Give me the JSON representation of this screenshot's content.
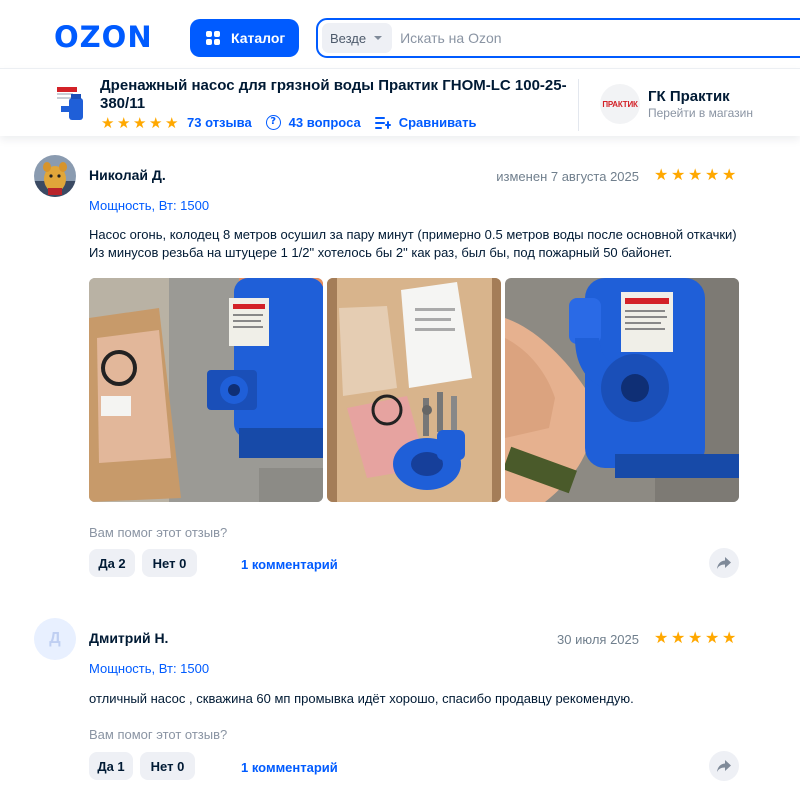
{
  "header": {
    "logo": "OZON",
    "catalog_label": "Каталог",
    "search_scope": "Везде",
    "search_placeholder": "Искать на Ozon"
  },
  "product": {
    "title": "Дренажный насос для грязной воды Практик ГНОМ-LC 100-25-380/11",
    "rating_stars": 5,
    "reviews_count": "73 отзыва",
    "questions_count": "43 вопроса",
    "compare_label": "Сравнивать"
  },
  "seller": {
    "logo_text": "ПРАКТИК",
    "name": "ГК Практик",
    "store_link": "Перейти в магазин"
  },
  "reviews": [
    {
      "author": "Николай Д.",
      "date": "изменен 7 августа 2025",
      "stars": 5,
      "variant": "Мощность, Вт: 1500",
      "text": "Насос огонь, колодец 8 метров осушил за пару минут (примерно 0.5 метров воды после основной откачки) Из минусов резьба на штуцере 1 1/2\" хотелось бы 2\" как раз, был бы, под пожарный 50 байонет.",
      "helpful_question": "Вам помог этот отзыв?",
      "yes_label": "Да 2",
      "no_label": "Нет 0",
      "comments_label": "1 комментарий"
    },
    {
      "author": "Дмитрий Н.",
      "avatar_letter": "Д",
      "date": "30 июля 2025",
      "stars": 5,
      "variant": "Мощность, Вт: 1500",
      "text": "отличный насос , скважина 60 мп промывка идёт хорошо, спасибо продавцу рекомендую.",
      "helpful_question": "Вам помог этот отзыв?",
      "yes_label": "Да 1",
      "no_label": "Нет 0",
      "comments_label": "1 комментарий"
    }
  ],
  "colors": {
    "accent": "#005bff",
    "star": "#ffa800",
    "pump_blue": "#1f5fd8",
    "text_primary": "#001a34",
    "text_secondary": "#8a94a3"
  }
}
